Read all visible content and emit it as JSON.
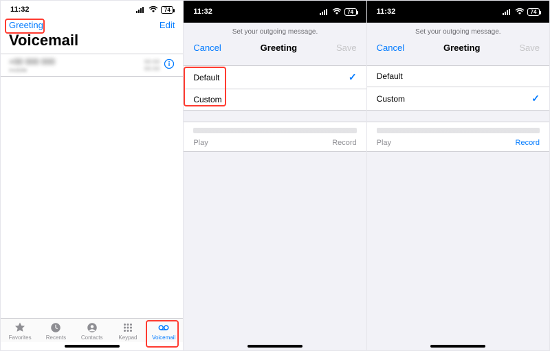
{
  "status": {
    "time": "11:32",
    "battery": "74"
  },
  "screen1": {
    "greeting_link": "Greeting",
    "edit_link": "Edit",
    "title": "Voicemail",
    "tabs": {
      "favorites": "Favorites",
      "recents": "Recents",
      "contacts": "Contacts",
      "keypad": "Keypad",
      "voicemail": "Voicemail"
    }
  },
  "sheet": {
    "note": "Set your outgoing message.",
    "cancel": "Cancel",
    "title": "Greeting",
    "save": "Save",
    "option_default": "Default",
    "option_custom": "Custom",
    "play": "Play",
    "record": "Record"
  }
}
